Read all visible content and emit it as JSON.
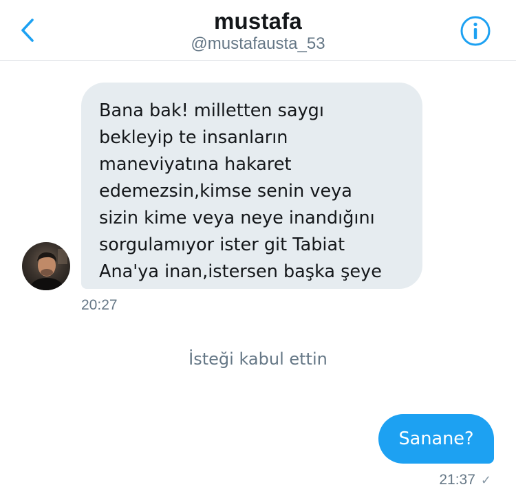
{
  "header": {
    "name": "mustafa",
    "handle": "@mustafausta_53",
    "back_icon": "chevron-left-icon",
    "info_icon": "info-icon",
    "accent_color": "#1da1f2"
  },
  "messages": {
    "incoming": {
      "text": "Bana bak! milletten saygı\nbekleyip te insanların\nmaneviyatına hakaret\nedemezsin,kimse senin veya\nsizin kime veya neye inandığını\nsorgulamıyor ister git Tabiat\nAna'ya inan,istersen başka şeye",
      "time": "20:27"
    },
    "system": "İsteği kabul ettin",
    "outgoing": {
      "text": "Sanane?",
      "time": "21:37",
      "status_icon": "check-icon"
    }
  }
}
